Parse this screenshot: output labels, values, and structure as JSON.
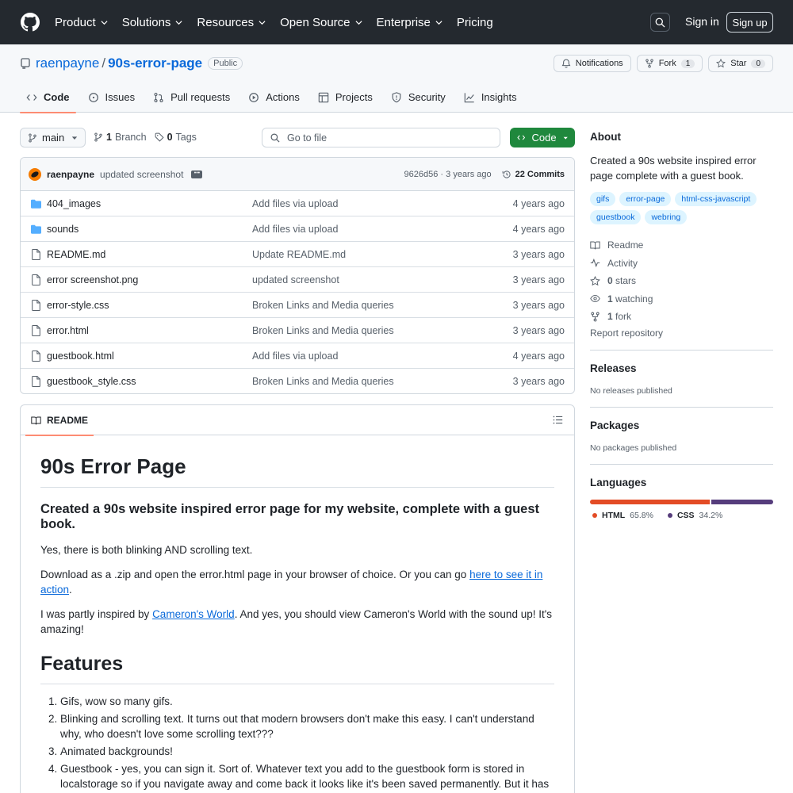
{
  "header": {
    "nav": [
      "Product",
      "Solutions",
      "Resources",
      "Open Source",
      "Enterprise",
      "Pricing"
    ],
    "sign_in": "Sign in",
    "sign_up": "Sign up"
  },
  "repo": {
    "owner": "raenpayne",
    "separator": "/",
    "name": "90s-error-page",
    "visibility": "Public",
    "notifications": "Notifications",
    "fork_label": "Fork",
    "fork_count": "1",
    "star_label": "Star",
    "star_count": "0"
  },
  "tabs": [
    "Code",
    "Issues",
    "Pull requests",
    "Actions",
    "Projects",
    "Security",
    "Insights"
  ],
  "toolbar": {
    "branch": "main",
    "branch_count": "1",
    "branch_word": "Branch",
    "tag_count": "0",
    "tag_word": "Tags",
    "goto_placeholder": "Go to file",
    "code_label": "Code"
  },
  "commit": {
    "author": "raenpayne",
    "message": "updated screenshot",
    "ellipsis": "•••",
    "meta": "9626d56 · 3 years ago",
    "count": "22 Commits"
  },
  "files": [
    {
      "name": "404_images",
      "type": "dir",
      "message": "Add files via upload",
      "age": "4 years ago"
    },
    {
      "name": "sounds",
      "type": "dir",
      "message": "Add files via upload",
      "age": "4 years ago"
    },
    {
      "name": "README.md",
      "type": "file",
      "message": "Update README.md",
      "age": "3 years ago"
    },
    {
      "name": "error screenshot.png",
      "type": "file",
      "message": "updated screenshot",
      "age": "3 years ago"
    },
    {
      "name": "error-style.css",
      "type": "file",
      "message": "Broken Links and Media queries",
      "age": "3 years ago"
    },
    {
      "name": "error.html",
      "type": "file",
      "message": "Broken Links and Media queries",
      "age": "3 years ago"
    },
    {
      "name": "guestbook.html",
      "type": "file",
      "message": "Add files via upload",
      "age": "4 years ago"
    },
    {
      "name": "guestbook_style.css",
      "type": "file",
      "message": "Broken Links and Media queries",
      "age": "3 years ago"
    }
  ],
  "readme": {
    "tab": "README",
    "h1": "90s Error Page",
    "h3": "Created a 90s website inspired error page for my website, complete with a guest book.",
    "p1": "Yes, there is both blinking AND scrolling text.",
    "p2_before": "Download as a .zip and open the error.html page in your browser of choice. Or you can go ",
    "p2_link": "here to see it in action",
    "p2_after": ".",
    "p3_before": "I was partly inspired by ",
    "p3_link": "Cameron's World",
    "p3_after": ". And yes, you should view Cameron's World with the sound up! It's amazing!",
    "h2": "Features",
    "features": [
      "Gifs, wow so many gifs.",
      "Blinking and scrolling text. It turns out that modern browsers don't make this easy. I can't understand why, who doesn't love some scrolling text???",
      "Animated backgrounds!",
      "Guestbook - yes, you can sign it. Sort of. Whatever text you add to the guestbook form is stored in localstorage so if you navigate away and come back it looks like it's been saved permanently. But it has not, because that seemed like too much effort."
    ]
  },
  "about": {
    "title": "About",
    "description": "Created a 90s website inspired error page complete with a guest book.",
    "topics": [
      "gifs",
      "error-page",
      "html-css-javascript",
      "guestbook",
      "webring"
    ],
    "readme": "Readme",
    "activity": "Activity",
    "stars_count": "0",
    "stars_word": "stars",
    "watching_count": "1",
    "watching_word": "watching",
    "fork_count": "1",
    "fork_word": "fork",
    "report": "Report repository"
  },
  "releases": {
    "title": "Releases",
    "text": "No releases published"
  },
  "packages": {
    "title": "Packages",
    "text": "No packages published"
  },
  "languages": {
    "title": "Languages",
    "items": [
      {
        "name": "HTML",
        "pct": "65.8%",
        "value": 65.8,
        "color": "#e34c26"
      },
      {
        "name": "CSS",
        "pct": "34.2%",
        "value": 34.2,
        "color": "#563d7c"
      }
    ]
  }
}
